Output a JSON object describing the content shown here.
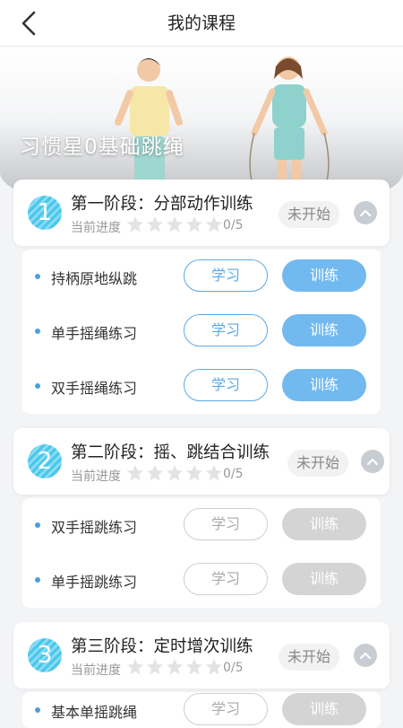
{
  "header": {
    "title": "我的课程"
  },
  "hero": {
    "title": "习惯星0基础跳绳"
  },
  "stages": [
    {
      "number": "1",
      "title": "第一阶段：分部动作训练",
      "progress_label": "当前进度",
      "rating": 0,
      "progress_count": "0/5",
      "status": "未开始",
      "items": [
        {
          "label": "持柄原地纵跳",
          "study": "学习",
          "train": "训练"
        },
        {
          "label": "单手摇绳练习",
          "study": "学习",
          "train": "训练"
        },
        {
          "label": "双手摇绳练习",
          "study": "学习",
          "train": "训练"
        }
      ]
    },
    {
      "number": "2",
      "title": "第二阶段：摇、跳结合训练",
      "progress_label": "当前进度",
      "rating": 0,
      "progress_count": "0/5",
      "status": "未开始",
      "items": [
        {
          "label": "双手摇跳练习",
          "study": "学习",
          "train": "训练"
        },
        {
          "label": "单手摇跳练习",
          "study": "学习",
          "train": "训练"
        }
      ]
    },
    {
      "number": "3",
      "title": "第三阶段：定时增次训练",
      "progress_label": "当前进度",
      "rating": 0,
      "progress_count": "0/5",
      "status": "未开始",
      "items": [
        {
          "label": "基本单摇跳绳",
          "study": "学习",
          "train": "训练"
        }
      ]
    }
  ],
  "colors": {
    "accent": "#72b9ef",
    "accent_border": "#5aa9e6",
    "stage_badge": "#49c7ec",
    "disabled": "#d4d4d4"
  }
}
